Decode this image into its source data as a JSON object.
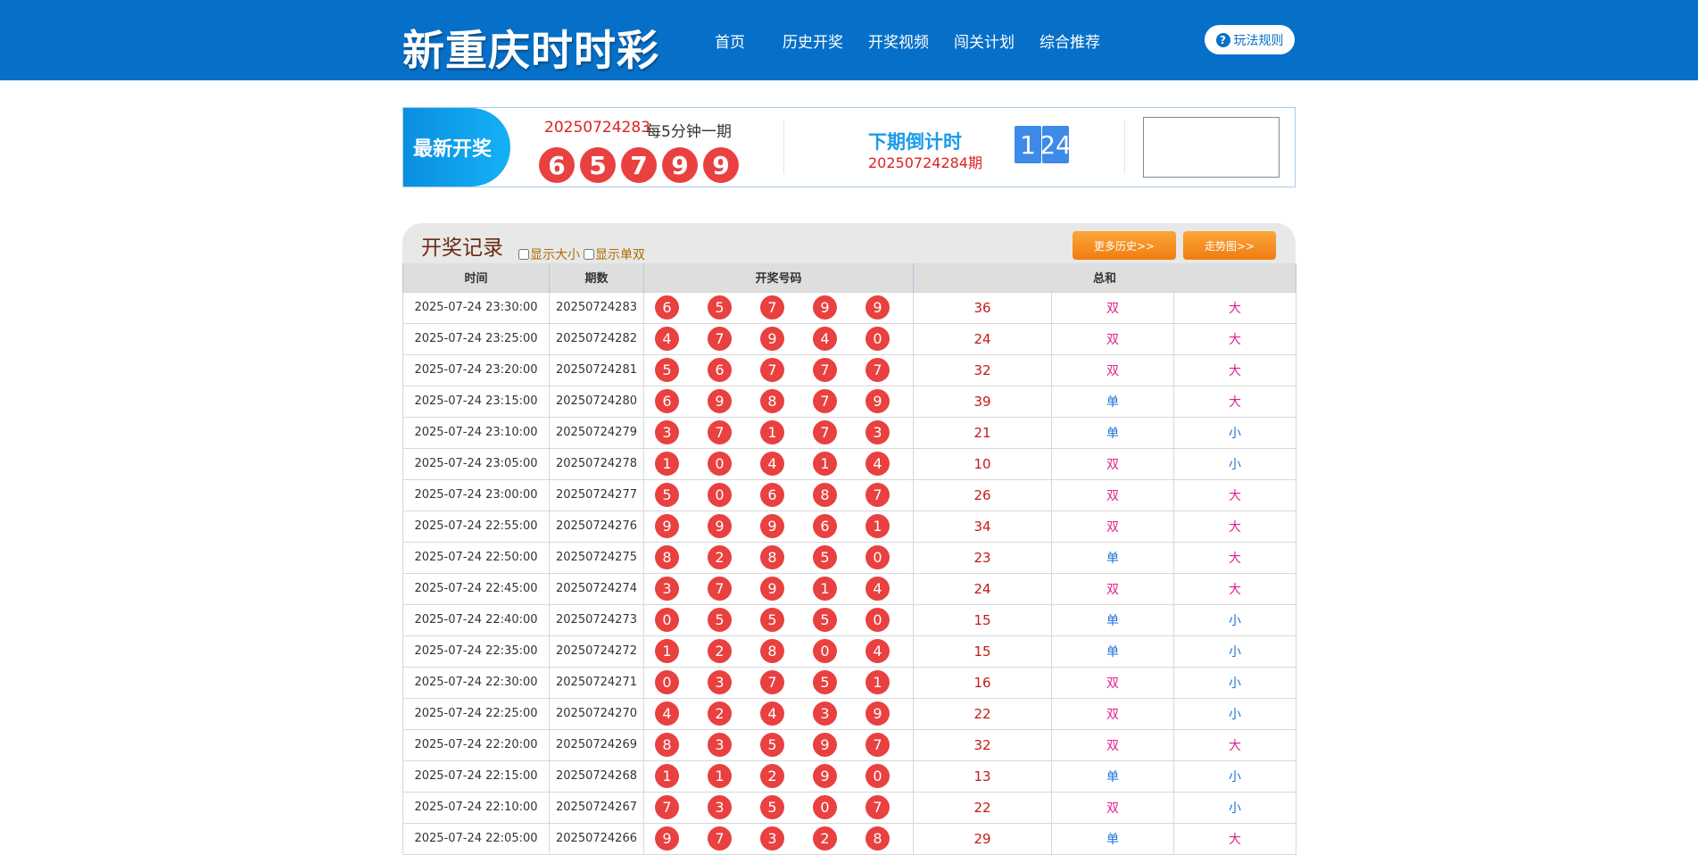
{
  "header": {
    "logo": "新重庆时时彩",
    "nav": [
      "首页",
      "历史开奖",
      "开奖视频",
      "闯关计划",
      "综合推荐"
    ],
    "rules_label": "玩法规则"
  },
  "latest": {
    "tag": "最新开奖",
    "issue": "20250724283",
    "frequency": "每5分钟一期",
    "balls": [
      "6",
      "5",
      "7",
      "9",
      "9"
    ],
    "countdown_title": "下期倒计时",
    "next_issue": "20250724284期",
    "countdown_digits": [
      "1",
      "24"
    ]
  },
  "records": {
    "title": "开奖记录",
    "show_size_label": "显示大小",
    "show_parity_label": "显示单双",
    "more_history_label": "更多历史>>",
    "trend_label": "走势图>>",
    "headers": [
      "时间",
      "期数",
      "开奖号码",
      "总和"
    ],
    "rows": [
      {
        "time": "2025-07-24 23:30:00",
        "issue": "20250724283",
        "balls": [
          "6",
          "5",
          "7",
          "9",
          "9"
        ],
        "sum": "36",
        "parity": "双",
        "size": "大"
      },
      {
        "time": "2025-07-24 23:25:00",
        "issue": "20250724282",
        "balls": [
          "4",
          "7",
          "9",
          "4",
          "0"
        ],
        "sum": "24",
        "parity": "双",
        "size": "大"
      },
      {
        "time": "2025-07-24 23:20:00",
        "issue": "20250724281",
        "balls": [
          "5",
          "6",
          "7",
          "7",
          "7"
        ],
        "sum": "32",
        "parity": "双",
        "size": "大"
      },
      {
        "time": "2025-07-24 23:15:00",
        "issue": "20250724280",
        "balls": [
          "6",
          "9",
          "8",
          "7",
          "9"
        ],
        "sum": "39",
        "parity": "单",
        "size": "大"
      },
      {
        "time": "2025-07-24 23:10:00",
        "issue": "20250724279",
        "balls": [
          "3",
          "7",
          "1",
          "7",
          "3"
        ],
        "sum": "21",
        "parity": "单",
        "size": "小"
      },
      {
        "time": "2025-07-24 23:05:00",
        "issue": "20250724278",
        "balls": [
          "1",
          "0",
          "4",
          "1",
          "4"
        ],
        "sum": "10",
        "parity": "双",
        "size": "小"
      },
      {
        "time": "2025-07-24 23:00:00",
        "issue": "20250724277",
        "balls": [
          "5",
          "0",
          "6",
          "8",
          "7"
        ],
        "sum": "26",
        "parity": "双",
        "size": "大"
      },
      {
        "time": "2025-07-24 22:55:00",
        "issue": "20250724276",
        "balls": [
          "9",
          "9",
          "9",
          "6",
          "1"
        ],
        "sum": "34",
        "parity": "双",
        "size": "大"
      },
      {
        "time": "2025-07-24 22:50:00",
        "issue": "20250724275",
        "balls": [
          "8",
          "2",
          "8",
          "5",
          "0"
        ],
        "sum": "23",
        "parity": "单",
        "size": "大"
      },
      {
        "time": "2025-07-24 22:45:00",
        "issue": "20250724274",
        "balls": [
          "3",
          "7",
          "9",
          "1",
          "4"
        ],
        "sum": "24",
        "parity": "双",
        "size": "大"
      },
      {
        "time": "2025-07-24 22:40:00",
        "issue": "20250724273",
        "balls": [
          "0",
          "5",
          "5",
          "5",
          "0"
        ],
        "sum": "15",
        "parity": "单",
        "size": "小"
      },
      {
        "time": "2025-07-24 22:35:00",
        "issue": "20250724272",
        "balls": [
          "1",
          "2",
          "8",
          "0",
          "4"
        ],
        "sum": "15",
        "parity": "单",
        "size": "小"
      },
      {
        "time": "2025-07-24 22:30:00",
        "issue": "20250724271",
        "balls": [
          "0",
          "3",
          "7",
          "5",
          "1"
        ],
        "sum": "16",
        "parity": "双",
        "size": "小"
      },
      {
        "time": "2025-07-24 22:25:00",
        "issue": "20250724270",
        "balls": [
          "4",
          "2",
          "4",
          "3",
          "9"
        ],
        "sum": "22",
        "parity": "双",
        "size": "小"
      },
      {
        "time": "2025-07-24 22:20:00",
        "issue": "20250724269",
        "balls": [
          "8",
          "3",
          "5",
          "9",
          "7"
        ],
        "sum": "32",
        "parity": "双",
        "size": "大"
      },
      {
        "time": "2025-07-24 22:15:00",
        "issue": "20250724268",
        "balls": [
          "1",
          "1",
          "2",
          "9",
          "0"
        ],
        "sum": "13",
        "parity": "单",
        "size": "小"
      },
      {
        "time": "2025-07-24 22:10:00",
        "issue": "20250724267",
        "balls": [
          "7",
          "3",
          "5",
          "0",
          "7"
        ],
        "sum": "22",
        "parity": "双",
        "size": "小"
      },
      {
        "time": "2025-07-24 22:05:00",
        "issue": "20250724266",
        "balls": [
          "9",
          "7",
          "3",
          "2",
          "8"
        ],
        "sum": "29",
        "parity": "单",
        "size": "大"
      }
    ]
  },
  "colors": {
    "header_bg": "#0670c8",
    "ball_red": "#e94040",
    "pink_label": "#e0208c",
    "blue_label": "#1a72d8",
    "orange_button": "#f08a20"
  }
}
